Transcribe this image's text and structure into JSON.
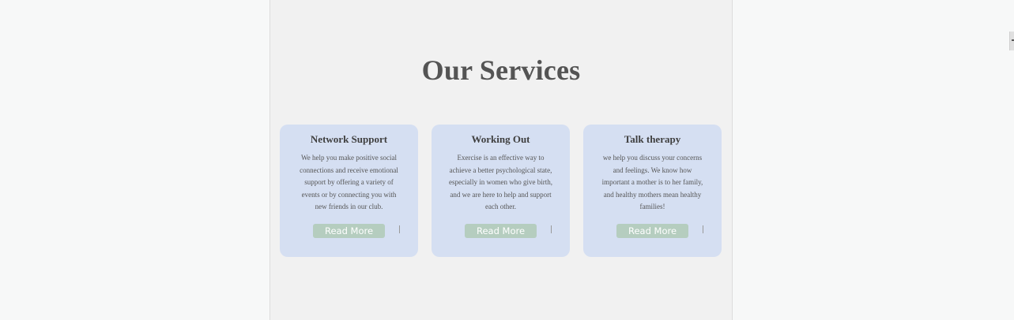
{
  "section": {
    "title": "Our Services"
  },
  "cards": [
    {
      "title": "Network Support",
      "text": "We help you make positive social connections and receive emotional support by offering a variety of events or by connecting you with new friends in our club.",
      "button": "Read More"
    },
    {
      "title": "Working Out",
      "text": "Exercise is an effective way to achieve a better psychological state, especially in women who give birth, and we are here to help and support each other.",
      "button": "Read More"
    },
    {
      "title": "Talk therapy",
      "text": "we help you discuss your concerns and feelings. We know how important a mother is to her family, and healthy mothers mean healthy families!",
      "button": "Read More"
    }
  ],
  "colors": {
    "page_bg": "#f7f8f8",
    "panel_bg": "#f1f1f1",
    "card_bg": "#d5dff2",
    "button_bg": "#b5cdbf",
    "title_text": "#545454"
  }
}
